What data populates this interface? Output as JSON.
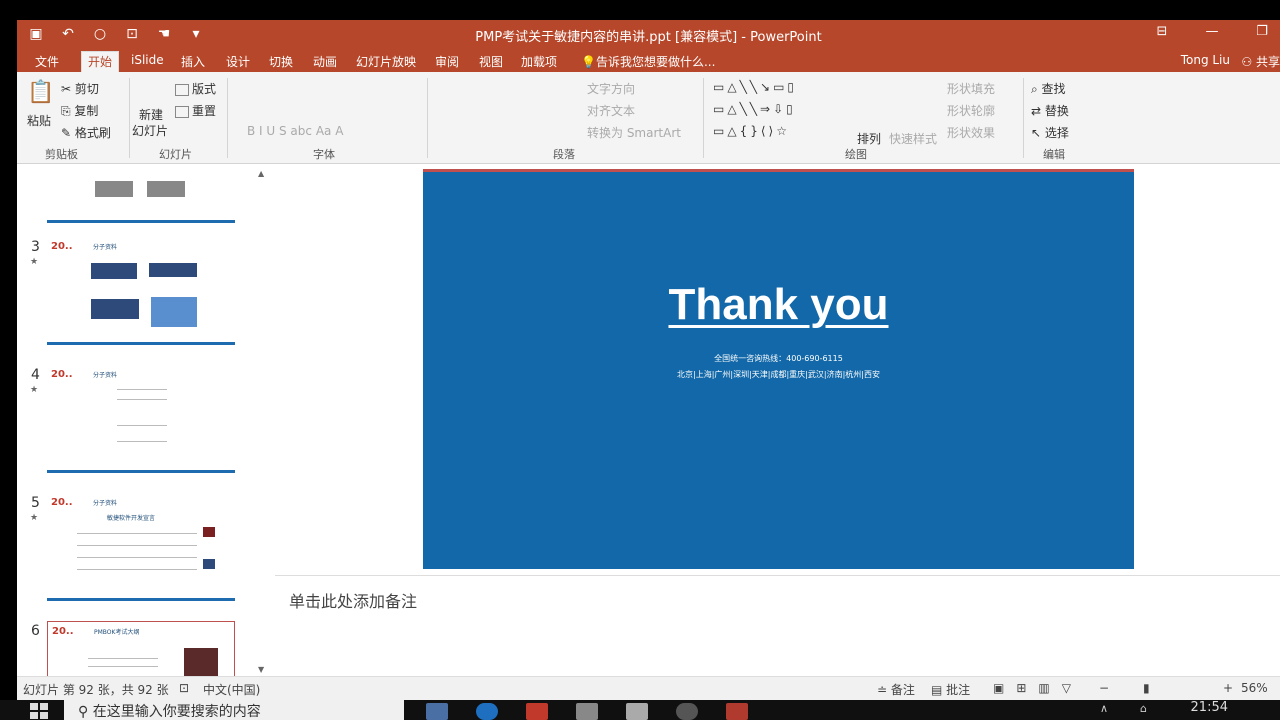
{
  "titlebar": {
    "title": "PMP考试关于敏捷内容的串讲.ppt [兼容模式] - PowerPoint",
    "qat": [
      "save-icon",
      "undo-icon",
      "redo-icon",
      "present-icon",
      "touch-icon",
      "customize-icon"
    ]
  },
  "tabs": {
    "items": [
      "文件",
      "开始",
      "iSlide",
      "插入",
      "设计",
      "切换",
      "动画",
      "幻灯片放映",
      "审阅",
      "视图",
      "加载项"
    ],
    "active": "开始",
    "tell_me": "告诉我您想要做什么...",
    "user": "Tong Liu",
    "share": "共享"
  },
  "ribbon": {
    "clipboard": {
      "paste": "粘贴",
      "cut": "剪切",
      "copy": "复制",
      "format_painter": "格式刷",
      "label": "剪贴板"
    },
    "slides": {
      "new_slide": "新建",
      "new_slide2": "幻灯片",
      "layout": "版式",
      "reset": "重置",
      "label": "幻灯片"
    },
    "font": {
      "label": "字体"
    },
    "paragraph": {
      "text_direction": "文字方向",
      "align_text": "对齐文本",
      "smartart": "转换为 SmartArt",
      "label": "段落"
    },
    "drawing": {
      "arrange": "排列",
      "quick_styles": "快速样式",
      "shape_fill": "形状填充",
      "shape_outline": "形状轮廓",
      "shape_effects": "形状效果",
      "label": "绘图"
    },
    "editing": {
      "find": "查找",
      "replace": "替换",
      "select": "选择",
      "label": "编辑"
    }
  },
  "thumbnails": [
    {
      "num": "3",
      "title": "分子资料"
    },
    {
      "num": "4",
      "title": "分子资料"
    },
    {
      "num": "5",
      "title": "分子资料",
      "subtitle": "敏捷软件开发宣言"
    },
    {
      "num": "6",
      "title": "PMBOK考试大纲"
    }
  ],
  "slide": {
    "headline": "Thank you",
    "hotline": "全国统一咨询热线：400-690-6115",
    "cities": "北京|上海|广州|深圳|天津|成都|重庆|武汉|济南|杭州|西安",
    "bg_color": "#1268a8"
  },
  "notes": {
    "placeholder": "单击此处添加备注"
  },
  "statusbar": {
    "slide_info": "幻灯片 第 92 张，共 92 张",
    "language": "中文(中国)",
    "notes_btn": "备注",
    "comments_btn": "批注",
    "zoom": "56%"
  },
  "taskbar": {
    "search_placeholder": "在这里输入你要搜索的内容",
    "time": "21:54"
  }
}
